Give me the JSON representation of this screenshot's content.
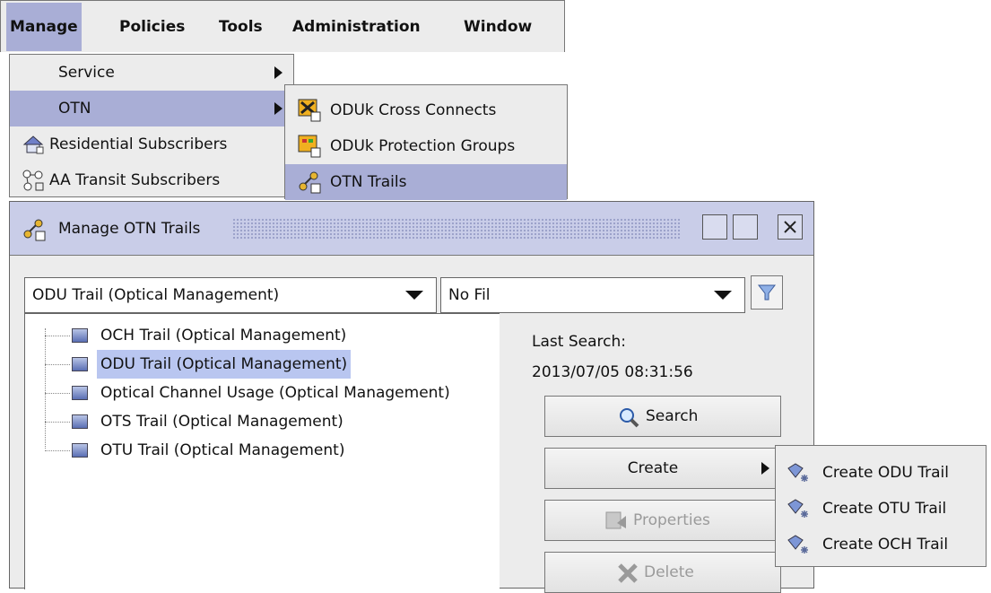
{
  "menubar": {
    "items": [
      {
        "label": "Manage",
        "active": true
      },
      {
        "label": "Policies"
      },
      {
        "label": "Tools"
      },
      {
        "label": "Administration"
      },
      {
        "label": "Window"
      }
    ]
  },
  "manage_menu": {
    "items": [
      {
        "label": "Service",
        "has_submenu": true
      },
      {
        "label": "OTN",
        "has_submenu": true,
        "active": true
      },
      {
        "label": "Residential Subscribers",
        "icon": "house-icon"
      },
      {
        "label": "AA Transit Subscribers",
        "icon": "network-icon"
      }
    ]
  },
  "otn_menu": {
    "items": [
      {
        "label": "ODUk Cross Connects",
        "icon": "cross-connect-icon"
      },
      {
        "label": "ODUk Protection Groups",
        "icon": "protection-group-icon"
      },
      {
        "label": "OTN Trails",
        "icon": "trails-icon",
        "active": true
      }
    ]
  },
  "window": {
    "title": "Manage OTN Trails",
    "object_type_select": "ODU Trail (Optical Management)",
    "filter_select": "No Fil",
    "last_search_label": "Last Search:",
    "last_search_value": "2013/07/05 08:31:56",
    "buttons": {
      "search": "Search",
      "create": "Create",
      "properties": "Properties",
      "delete": "Delete"
    },
    "tree": [
      {
        "label": "OCH Trail (Optical Management)"
      },
      {
        "label": "ODU Trail (Optical Management)",
        "selected": true
      },
      {
        "label": "Optical Channel Usage (Optical Management)"
      },
      {
        "label": "OTS Trail (Optical Management)"
      },
      {
        "label": "OTU Trail (Optical Management)"
      }
    ]
  },
  "create_menu": {
    "items": [
      {
        "label": "Create ODU Trail"
      },
      {
        "label": "Create OTU Trail"
      },
      {
        "label": "Create OCH Trail"
      }
    ]
  },
  "colors": {
    "menu_bg": "#ececec",
    "highlight": "#a9aed6",
    "title_bg": "#c9cde8"
  }
}
